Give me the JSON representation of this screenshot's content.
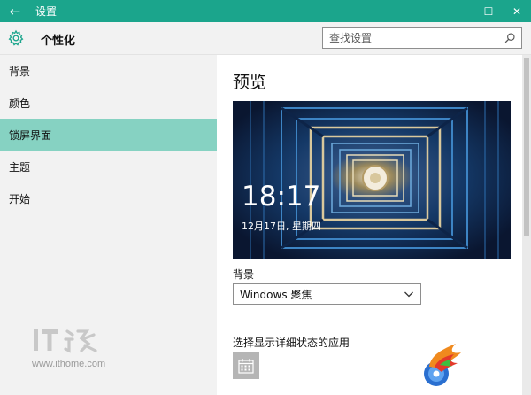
{
  "window": {
    "title": "设置",
    "back_glyph": "←",
    "minimize_glyph": "—",
    "maximize_glyph": "☐",
    "close_glyph": "✕"
  },
  "header": {
    "title": "个性化",
    "icon": "gear-icon"
  },
  "search": {
    "placeholder": "查找设置",
    "value": ""
  },
  "sidebar": {
    "items": [
      {
        "label": "背景",
        "active": false
      },
      {
        "label": "颜色",
        "active": false
      },
      {
        "label": "锁屏界面",
        "active": true
      },
      {
        "label": "主题",
        "active": false
      },
      {
        "label": "开始",
        "active": false
      }
    ]
  },
  "main": {
    "preview_title": "预览",
    "preview_time": "18:17",
    "preview_date": "12月17日, 星期四",
    "background_label": "背景",
    "background_select": "Windows 聚焦",
    "status_label": "选择显示详细状态的应用"
  },
  "watermark": {
    "url": "www.ithome.com",
    "logo_text": "IT之家"
  },
  "colors": {
    "accent": "#1ba58c",
    "nav_active": "#86d2c2",
    "sidebar_bg": "#f2f2f2"
  }
}
